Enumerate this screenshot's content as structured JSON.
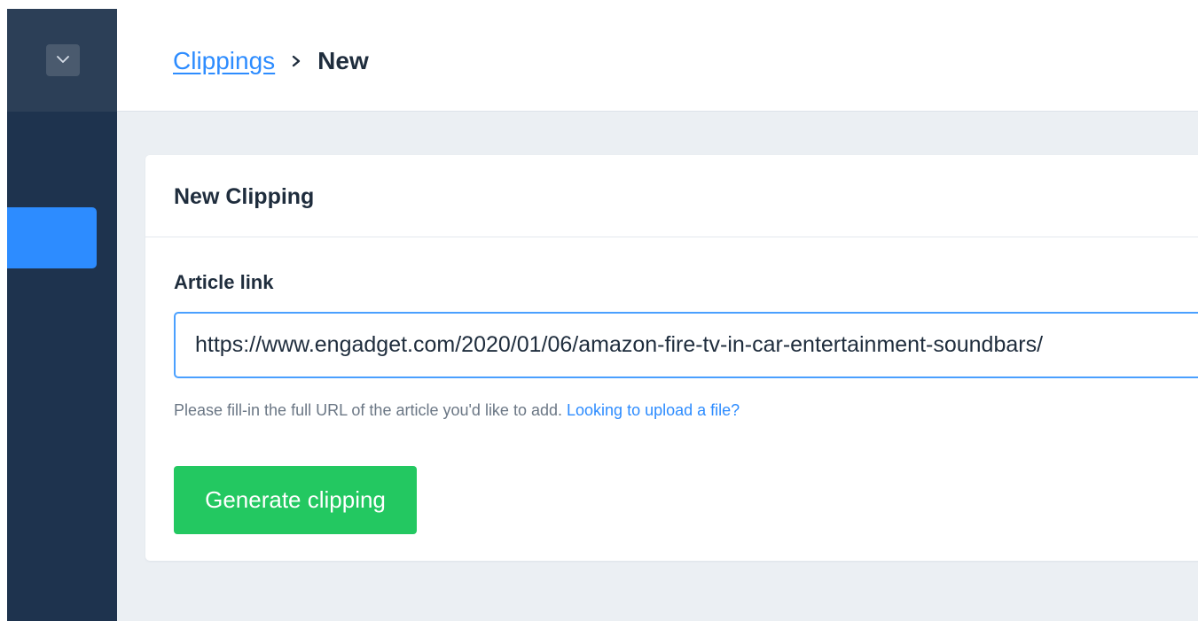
{
  "breadcrumb": {
    "parent_label": "Clippings",
    "current_label": "New"
  },
  "sidebar": {
    "toggle_icon": "chevron-down-icon",
    "accent_color": "#2d8cff",
    "background_color": "#1e334e"
  },
  "card": {
    "title": "New Clipping",
    "field_label": "Article link",
    "input_value": "https://www.engadget.com/2020/01/06/amazon-fire-tv-in-car-entertainment-soundbars/",
    "help_text": "Please fill-in the full URL of the article you'd like to add.",
    "help_link": "Looking to upload a file?",
    "submit_label": "Generate clipping",
    "submit_color": "#23c861"
  }
}
